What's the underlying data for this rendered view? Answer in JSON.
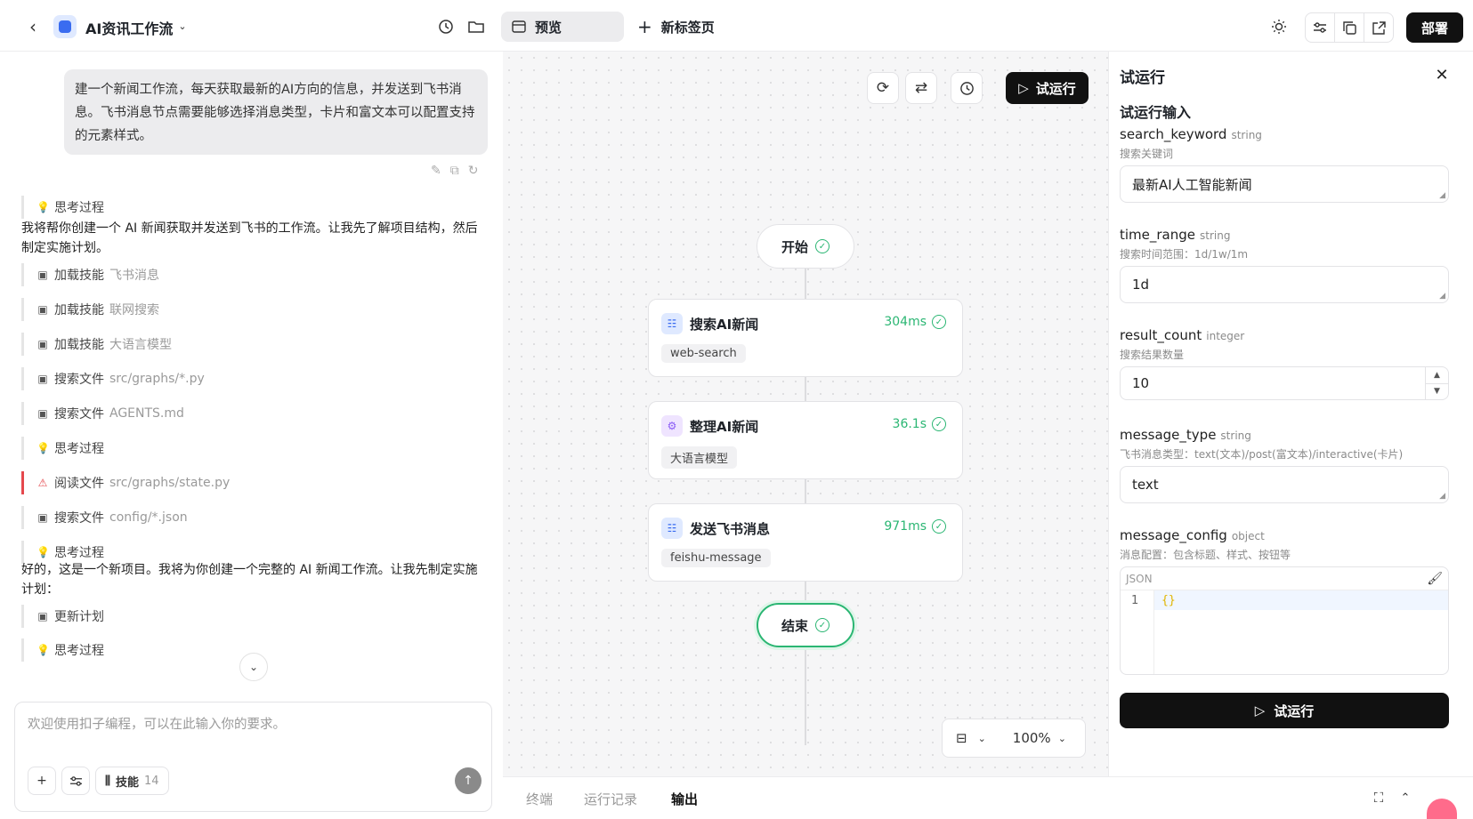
{
  "header": {
    "app_title": "AI资讯工作流",
    "tab_preview": "预览",
    "tab_new": "新标签页",
    "deploy": "部署"
  },
  "chat": {
    "user_message": "建一个新闻工作流，每天获取最新的AI方向的信息，并发送到飞书消息。飞书消息节点需要能够选择消息类型，卡片和富文本可以配置支持的元素样式。",
    "steps_a": [
      {
        "label": "思考过程",
        "detail": "",
        "icon": "bulb-icon"
      }
    ],
    "para1": "我将帮你创建一个 AI 新闻获取并发送到飞书的工作流。让我先了解项目结构，然后制定实施计划。",
    "steps_b": [
      {
        "label": "加载技能",
        "detail": "飞书消息",
        "icon": "terminal-icon"
      },
      {
        "label": "加载技能",
        "detail": "联网搜索",
        "icon": "terminal-icon"
      },
      {
        "label": "加载技能",
        "detail": "大语言模型",
        "icon": "terminal-icon"
      },
      {
        "label": "搜索文件",
        "detail": "src/graphs/*.py",
        "icon": "terminal-icon"
      },
      {
        "label": "搜索文件",
        "detail": "AGENTS.md",
        "icon": "terminal-icon"
      },
      {
        "label": "思考过程",
        "detail": "",
        "icon": "bulb-icon"
      },
      {
        "label": "阅读文件",
        "detail": "src/graphs/state.py",
        "icon": "warning-icon",
        "status": "error"
      },
      {
        "label": "搜索文件",
        "detail": "config/*.json",
        "icon": "terminal-icon"
      },
      {
        "label": "思考过程",
        "detail": "",
        "icon": "bulb-icon"
      }
    ],
    "para2": "好的，这是一个新项目。我将为你创建一个完整的 AI 新闻工作流。让我先制定实施计划：",
    "steps_c": [
      {
        "label": "更新计划",
        "detail": "",
        "icon": "terminal-icon"
      },
      {
        "label": "思考过程",
        "detail": "",
        "icon": "bulb-icon"
      }
    ],
    "composer_placeholder": "欢迎使用扣子编程，可以在此输入你的要求。",
    "skills_label": "技能",
    "skills_count": "14"
  },
  "canvas": {
    "run_label": "试运行",
    "start": "开始",
    "end": "结束",
    "nodes": [
      {
        "title": "搜索AI新闻",
        "time": "304ms",
        "tag": "web-search",
        "icon_color": "#dfe9ff"
      },
      {
        "title": "整理AI新闻",
        "time": "36.1s",
        "tag": "大语言模型",
        "icon_color": "#efe4ff"
      },
      {
        "title": "发送飞书消息",
        "time": "971ms",
        "tag": "feishu-message",
        "icon_color": "#dfe9ff"
      }
    ],
    "zoom": "100%"
  },
  "bottom_tabs": [
    "终端",
    "运行记录",
    "输出"
  ],
  "panel": {
    "title": "试运行",
    "subtitle": "试运行输入",
    "fields": [
      {
        "name": "search_keyword",
        "type": "string",
        "desc": "搜索关键词",
        "value": "最新AI人工智能新闻"
      },
      {
        "name": "time_range",
        "type": "string",
        "desc": "搜索时间范围：1d/1w/1m",
        "value": "1d"
      },
      {
        "name": "result_count",
        "type": "integer",
        "desc": "搜索结果数量",
        "value": "10"
      },
      {
        "name": "message_type",
        "type": "string",
        "desc": "飞书消息类型：text(文本)/post(富文本)/interactive(卡片)",
        "value": "text"
      },
      {
        "name": "message_config",
        "type": "object",
        "desc": "消息配置：包含标题、样式、按钮等",
        "value": "{}"
      }
    ],
    "json_label": "JSON",
    "json_line": "1",
    "run_button": "试运行"
  },
  "colors": {
    "accent_green": "#2bb673",
    "error_red": "#e5484d",
    "primary_dark": "#111111"
  }
}
